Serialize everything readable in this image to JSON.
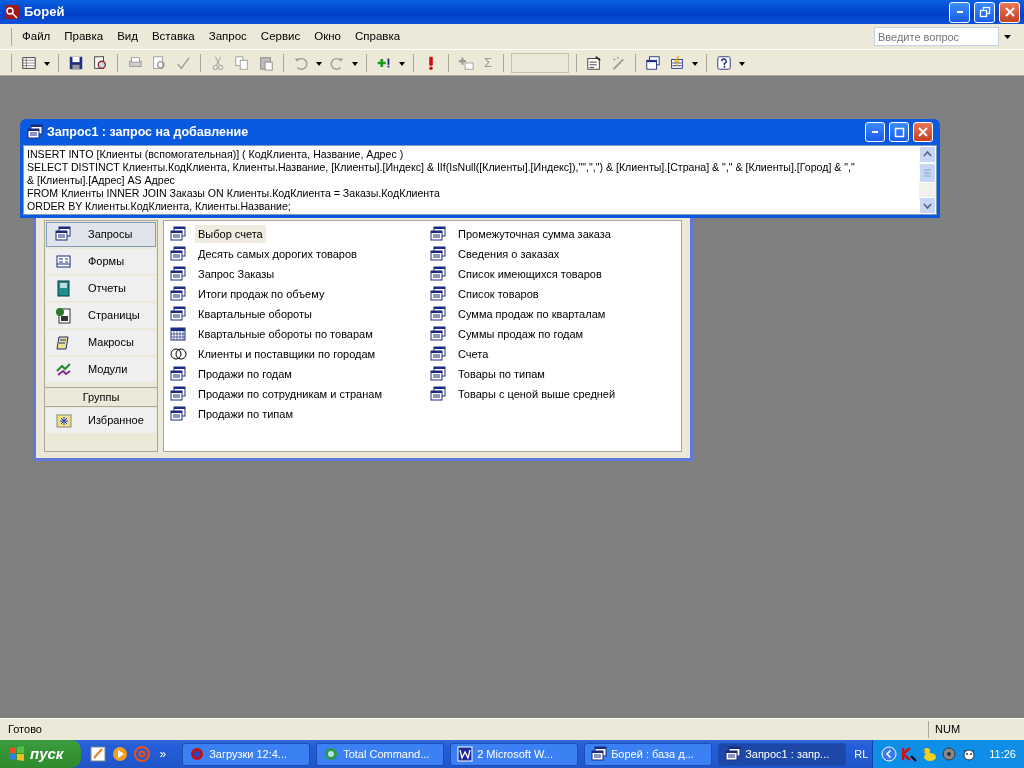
{
  "app": {
    "title": "Борей"
  },
  "menu": [
    "Файл",
    "Правка",
    "Вид",
    "Вставка",
    "Запрос",
    "Сервис",
    "Окно",
    "Справка"
  ],
  "help_search": {
    "placeholder": "Введите вопрос"
  },
  "toolbar": {
    "totals_symbol": "Σ"
  },
  "query_window": {
    "title": "Запрос1 : запрос на добавление",
    "sql_lines": [
      "INSERT INTO [Клиенты (вспомогательная)] ( КодКлиента, Название, Адрес )",
      "SELECT DISTINCT Клиенты.КодКлиента, Клиенты.Название, [Клиенты].[Индекс] & IIf(IsNull([Клиенты].[Индекс]),\"\",\",\") & [Клиенты].[Страна] & \",\" & [Клиенты].[Город] & \",\"",
      "& [Клиенты].[Адрес] AS Адрес",
      "FROM Клиенты INNER JOIN Заказы ON Клиенты.КодКлиента = Заказы.КодКлиента",
      "ORDER BY Клиенты.КодКлиента, Клиенты.Название;"
    ]
  },
  "database_window": {
    "objects": [
      {
        "label": "Запросы",
        "selected": true
      },
      {
        "label": "Формы",
        "selected": false
      },
      {
        "label": "Отчеты",
        "selected": false
      },
      {
        "label": "Страницы",
        "selected": false
      },
      {
        "label": "Макросы",
        "selected": false
      },
      {
        "label": "Модули",
        "selected": false
      }
    ],
    "groups_header": "Группы",
    "groups": [
      {
        "label": "Избранное",
        "selected": false
      }
    ],
    "items": [
      {
        "label": "Выбор счета",
        "kind": "select",
        "selected": true
      },
      {
        "label": "Десять самых дорогих товаров",
        "kind": "select",
        "selected": false
      },
      {
        "label": "Запрос Заказы",
        "kind": "select",
        "selected": false
      },
      {
        "label": "Итоги продаж по объему",
        "kind": "select",
        "selected": false
      },
      {
        "label": "Квартальные обороты",
        "kind": "select",
        "selected": false
      },
      {
        "label": "Квартальные обороты по товарам",
        "kind": "crosstab",
        "selected": false
      },
      {
        "label": "Клиенты и поставщики по городам",
        "kind": "union",
        "selected": false
      },
      {
        "label": "Продажи по годам",
        "kind": "select",
        "selected": false
      },
      {
        "label": "Продажи по сотрудникам и странам",
        "kind": "select",
        "selected": false
      },
      {
        "label": "Продажи по типам",
        "kind": "select",
        "selected": false
      },
      {
        "label": "Промежуточная сумма заказа",
        "kind": "select",
        "selected": false
      },
      {
        "label": "Сведения о заказах",
        "kind": "select",
        "selected": false
      },
      {
        "label": "Список имеющихся товаров",
        "kind": "select",
        "selected": false
      },
      {
        "label": "Список товаров",
        "kind": "select",
        "selected": false
      },
      {
        "label": "Сумма продаж по кварталам",
        "kind": "select",
        "selected": false
      },
      {
        "label": "Суммы продаж по годам",
        "kind": "select",
        "selected": false
      },
      {
        "label": "Счета",
        "kind": "select",
        "selected": false
      },
      {
        "label": "Товары по типам",
        "kind": "select",
        "selected": false
      },
      {
        "label": "Товары с ценой выше средней",
        "kind": "select",
        "selected": false
      }
    ]
  },
  "status_bar": {
    "text": "Готово",
    "indicator": "NUM"
  },
  "taskbar": {
    "start": "пуск",
    "quick_launch_more": "»",
    "tasks": [
      {
        "label": "Загрузки 12:4...",
        "selected": false
      },
      {
        "label": "Total Command...",
        "selected": false
      },
      {
        "label": "2 Microsoft W...",
        "selected": false
      },
      {
        "label": "Борей : база д...",
        "selected": false
      },
      {
        "label": "Запрос1 : запр...",
        "selected": true
      }
    ],
    "language": "RL",
    "clock": "11:26"
  }
}
